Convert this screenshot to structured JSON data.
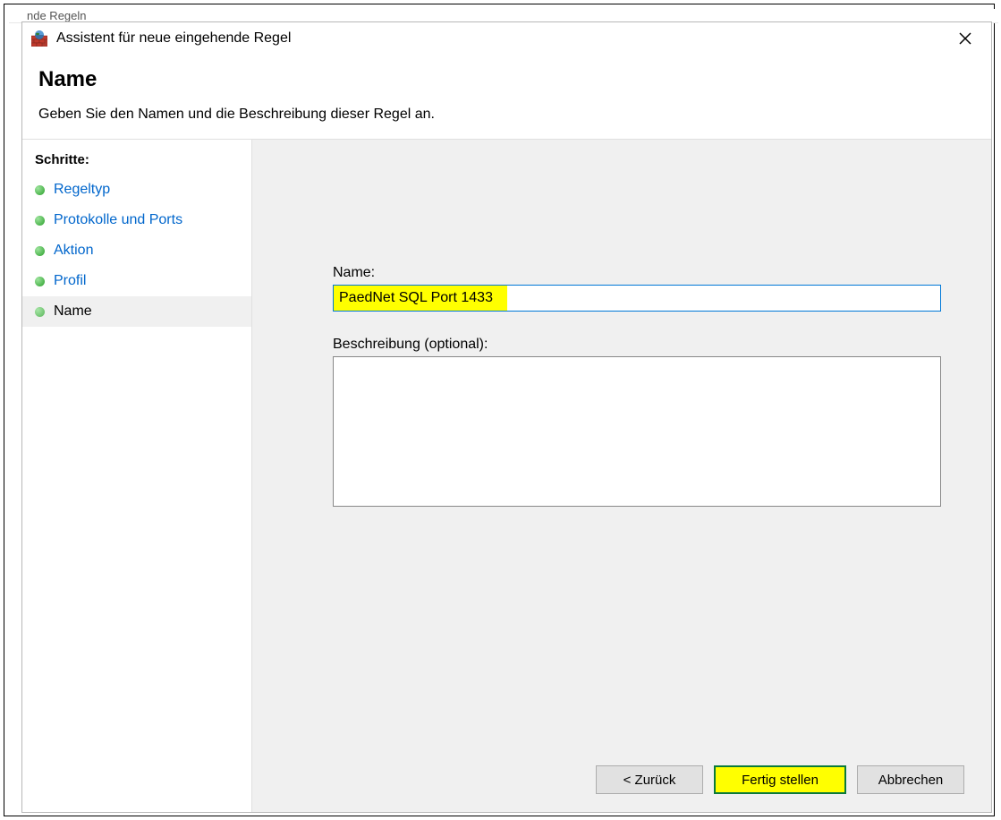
{
  "bg_fragment": "nde Regeln",
  "dialog": {
    "title": "Assistent für neue eingehende Regel",
    "header_title": "Name",
    "header_sub": "Geben Sie den Namen und die Beschreibung dieser Regel an."
  },
  "sidebar": {
    "heading": "Schritte:",
    "steps": [
      {
        "label": "Regeltyp",
        "state": "completed"
      },
      {
        "label": "Protokolle und Ports",
        "state": "completed"
      },
      {
        "label": "Aktion",
        "state": "completed"
      },
      {
        "label": "Profil",
        "state": "completed"
      },
      {
        "label": "Name",
        "state": "current"
      }
    ]
  },
  "form": {
    "name_label": "Name:",
    "name_value": "PaedNet SQL Port 1433",
    "desc_label": "Beschreibung (optional):",
    "desc_value": ""
  },
  "buttons": {
    "back": "< Zurück",
    "finish": "Fertig stellen",
    "cancel": "Abbrechen"
  }
}
